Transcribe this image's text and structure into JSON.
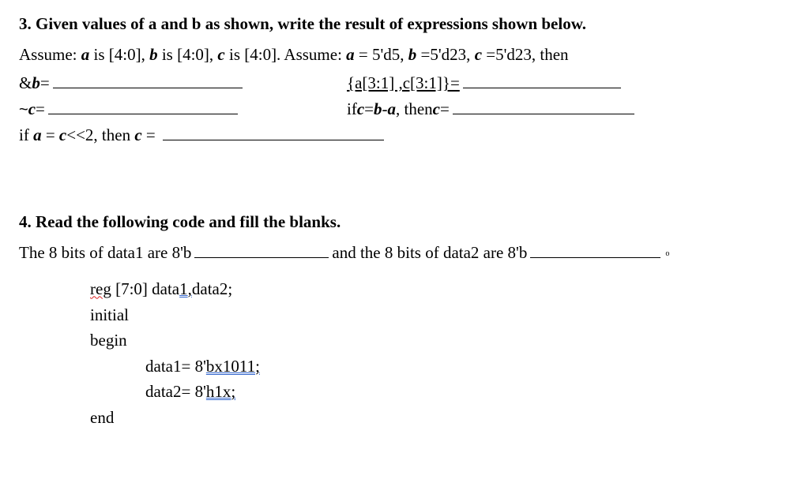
{
  "q3": {
    "title": "3. Given values of a and b as shown, write the result of expressions shown below.",
    "assume_prefix": "Assume: ",
    "a_label": "a",
    "is_txt": " is [4:0], ",
    "b_label": "b",
    "c_label": "c",
    "assume2_prefix": " is [4:0]. Assume: ",
    "a_eq": " = 5'd5, ",
    "b_eq": " =5'd23, ",
    "c_eq": " =5'd23, then",
    "and_b_lhs": "&",
    "and_b_var": "b",
    "eq_sign": "=",
    "concat_lhs": "{a[3:1] ,c[3:1]}=",
    "not_c_tilde": "~ ",
    "not_c_var": "c",
    "not_c_eq": " =",
    "ifc_prefix": "if ",
    "ifc_mid": " = ",
    "ifc_minus": " - ",
    "ifc_comma": " ,   then ",
    "ifc_then_c": "c",
    "ifc_eq2": " =",
    "ifa_prefix": "if ",
    "ifa_mid": " = ",
    "ifa_shift": "<<2, then ",
    "ifa_then_c": "c",
    "ifa_eq": " ="
  },
  "q4": {
    "title": "4. Read the following code and fill the blanks.",
    "sentence_a": "The 8 bits of data1 are 8'b",
    "sentence_b": "and the 8 bits of data2 are 8'b",
    "code": {
      "reg_kw": "reg",
      "reg_rest": " [7:0] data",
      "reg_one": "1",
      "reg_comma": ",",
      "reg_data2": "data2;",
      "initial": "initial",
      "begin": "begin",
      "d1a": "data1= 8'",
      "d1b": "bx1011;",
      "d2a": "data2= 8'",
      "d2b": "h1x;",
      "end": "end"
    }
  }
}
